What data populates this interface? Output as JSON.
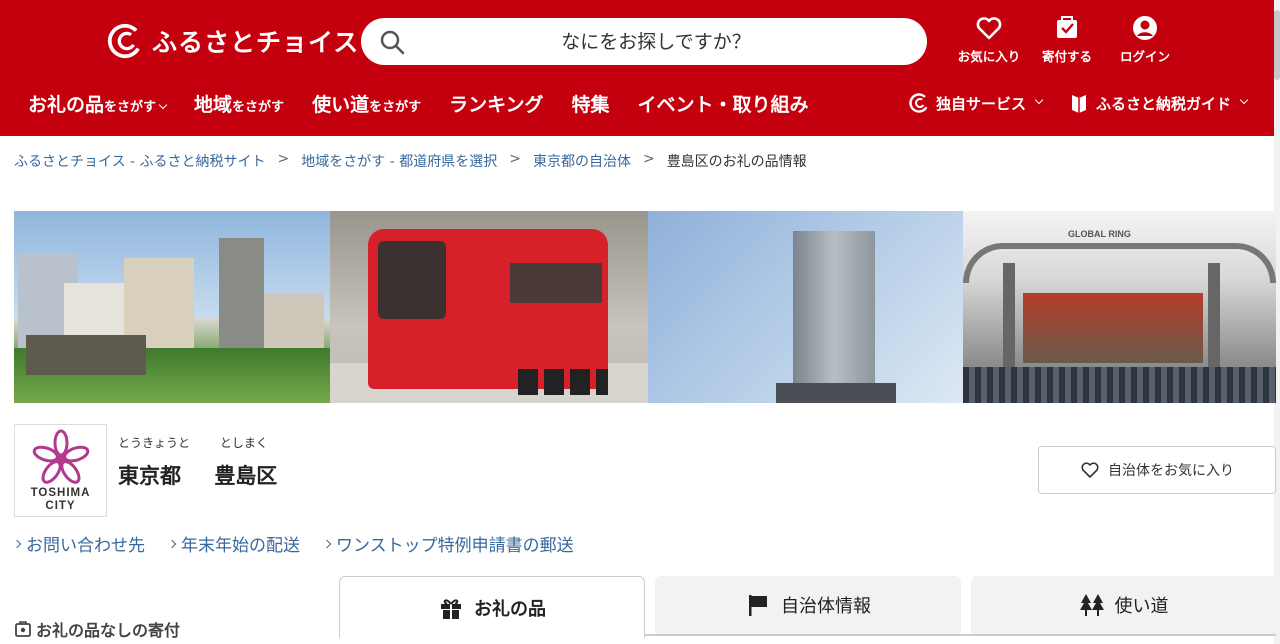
{
  "header": {
    "logo_text": "ふるさとチョイス",
    "search_placeholder": "なにをお探しですか？",
    "icons": [
      {
        "name": "heart-icon",
        "label": "お気に入り"
      },
      {
        "name": "bag-icon",
        "label": "寄付する"
      },
      {
        "name": "user-icon",
        "label": "ログイン"
      }
    ],
    "nav": [
      {
        "main": "お礼の品",
        "sub": "をさがす",
        "chevron": true
      },
      {
        "main": "地域",
        "sub": "をさがす",
        "chevron": false
      },
      {
        "main": "使い道",
        "sub": "をさがす",
        "chevron": false
      },
      {
        "main": "ランキング",
        "sub": "",
        "chevron": false
      },
      {
        "main": "特集",
        "sub": "",
        "chevron": false
      },
      {
        "main": "イベント・取り組み",
        "sub": "",
        "chevron": false
      }
    ],
    "nav_right": [
      {
        "label": "独自サービス",
        "icon": "choice-logo-icon"
      },
      {
        "label": "ふるさと納税ガイド",
        "icon": "book-icon"
      }
    ],
    "brand_color": "#c4000e"
  },
  "breadcrumb": [
    {
      "label": "ふるさとチョイス - ふるさと納税サイト",
      "link": true
    },
    {
      "label": "地域をさがす - 都道府県を選択",
      "link": true
    },
    {
      "label": "東京都の自治体",
      "link": true
    },
    {
      "label": "豊島区のお礼の品情報",
      "link": false
    }
  ],
  "municipality": {
    "logo_text_1": "TOSHIMA",
    "logo_text_2": "CITY",
    "furigana_pref": "とうきょうと",
    "furigana_city": "としまく",
    "prefecture": "東京都",
    "city": "豊島区",
    "favorite_button": "自治体をお気に入り"
  },
  "links": [
    "お問い合わせ先",
    "年末年始の配送",
    "ワンストップ特例申請書の郵送"
  ],
  "side_label": "お礼の品なしの寄付",
  "tabs": [
    {
      "label": "お礼の品",
      "icon": "gift-icon",
      "active": true
    },
    {
      "label": "自治体情報",
      "icon": "flag-icon",
      "active": false
    },
    {
      "label": "使い道",
      "icon": "trees-icon",
      "active": false
    }
  ],
  "banner": {
    "panel_4_sign": "GLOBAL RING"
  }
}
